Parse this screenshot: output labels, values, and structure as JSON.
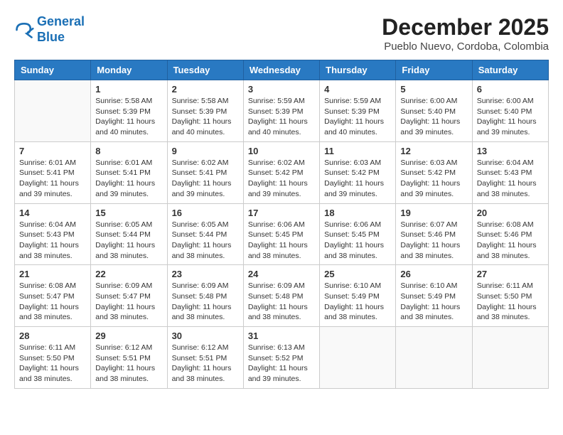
{
  "logo": {
    "line1": "General",
    "line2": "Blue"
  },
  "title": "December 2025",
  "location": "Pueblo Nuevo, Cordoba, Colombia",
  "weekdays": [
    "Sunday",
    "Monday",
    "Tuesday",
    "Wednesday",
    "Thursday",
    "Friday",
    "Saturday"
  ],
  "weeks": [
    [
      {
        "day": "",
        "info": ""
      },
      {
        "day": "1",
        "info": "Sunrise: 5:58 AM\nSunset: 5:39 PM\nDaylight: 11 hours and 40 minutes."
      },
      {
        "day": "2",
        "info": "Sunrise: 5:58 AM\nSunset: 5:39 PM\nDaylight: 11 hours and 40 minutes."
      },
      {
        "day": "3",
        "info": "Sunrise: 5:59 AM\nSunset: 5:39 PM\nDaylight: 11 hours and 40 minutes."
      },
      {
        "day": "4",
        "info": "Sunrise: 5:59 AM\nSunset: 5:39 PM\nDaylight: 11 hours and 40 minutes."
      },
      {
        "day": "5",
        "info": "Sunrise: 6:00 AM\nSunset: 5:40 PM\nDaylight: 11 hours and 39 minutes."
      },
      {
        "day": "6",
        "info": "Sunrise: 6:00 AM\nSunset: 5:40 PM\nDaylight: 11 hours and 39 minutes."
      }
    ],
    [
      {
        "day": "7",
        "info": "Sunrise: 6:01 AM\nSunset: 5:41 PM\nDaylight: 11 hours and 39 minutes."
      },
      {
        "day": "8",
        "info": "Sunrise: 6:01 AM\nSunset: 5:41 PM\nDaylight: 11 hours and 39 minutes."
      },
      {
        "day": "9",
        "info": "Sunrise: 6:02 AM\nSunset: 5:41 PM\nDaylight: 11 hours and 39 minutes."
      },
      {
        "day": "10",
        "info": "Sunrise: 6:02 AM\nSunset: 5:42 PM\nDaylight: 11 hours and 39 minutes."
      },
      {
        "day": "11",
        "info": "Sunrise: 6:03 AM\nSunset: 5:42 PM\nDaylight: 11 hours and 39 minutes."
      },
      {
        "day": "12",
        "info": "Sunrise: 6:03 AM\nSunset: 5:42 PM\nDaylight: 11 hours and 39 minutes."
      },
      {
        "day": "13",
        "info": "Sunrise: 6:04 AM\nSunset: 5:43 PM\nDaylight: 11 hours and 38 minutes."
      }
    ],
    [
      {
        "day": "14",
        "info": "Sunrise: 6:04 AM\nSunset: 5:43 PM\nDaylight: 11 hours and 38 minutes."
      },
      {
        "day": "15",
        "info": "Sunrise: 6:05 AM\nSunset: 5:44 PM\nDaylight: 11 hours and 38 minutes."
      },
      {
        "day": "16",
        "info": "Sunrise: 6:05 AM\nSunset: 5:44 PM\nDaylight: 11 hours and 38 minutes."
      },
      {
        "day": "17",
        "info": "Sunrise: 6:06 AM\nSunset: 5:45 PM\nDaylight: 11 hours and 38 minutes."
      },
      {
        "day": "18",
        "info": "Sunrise: 6:06 AM\nSunset: 5:45 PM\nDaylight: 11 hours and 38 minutes."
      },
      {
        "day": "19",
        "info": "Sunrise: 6:07 AM\nSunset: 5:46 PM\nDaylight: 11 hours and 38 minutes."
      },
      {
        "day": "20",
        "info": "Sunrise: 6:08 AM\nSunset: 5:46 PM\nDaylight: 11 hours and 38 minutes."
      }
    ],
    [
      {
        "day": "21",
        "info": "Sunrise: 6:08 AM\nSunset: 5:47 PM\nDaylight: 11 hours and 38 minutes."
      },
      {
        "day": "22",
        "info": "Sunrise: 6:09 AM\nSunset: 5:47 PM\nDaylight: 11 hours and 38 minutes."
      },
      {
        "day": "23",
        "info": "Sunrise: 6:09 AM\nSunset: 5:48 PM\nDaylight: 11 hours and 38 minutes."
      },
      {
        "day": "24",
        "info": "Sunrise: 6:09 AM\nSunset: 5:48 PM\nDaylight: 11 hours and 38 minutes."
      },
      {
        "day": "25",
        "info": "Sunrise: 6:10 AM\nSunset: 5:49 PM\nDaylight: 11 hours and 38 minutes."
      },
      {
        "day": "26",
        "info": "Sunrise: 6:10 AM\nSunset: 5:49 PM\nDaylight: 11 hours and 38 minutes."
      },
      {
        "day": "27",
        "info": "Sunrise: 6:11 AM\nSunset: 5:50 PM\nDaylight: 11 hours and 38 minutes."
      }
    ],
    [
      {
        "day": "28",
        "info": "Sunrise: 6:11 AM\nSunset: 5:50 PM\nDaylight: 11 hours and 38 minutes."
      },
      {
        "day": "29",
        "info": "Sunrise: 6:12 AM\nSunset: 5:51 PM\nDaylight: 11 hours and 38 minutes."
      },
      {
        "day": "30",
        "info": "Sunrise: 6:12 AM\nSunset: 5:51 PM\nDaylight: 11 hours and 38 minutes."
      },
      {
        "day": "31",
        "info": "Sunrise: 6:13 AM\nSunset: 5:52 PM\nDaylight: 11 hours and 39 minutes."
      },
      {
        "day": "",
        "info": ""
      },
      {
        "day": "",
        "info": ""
      },
      {
        "day": "",
        "info": ""
      }
    ]
  ]
}
